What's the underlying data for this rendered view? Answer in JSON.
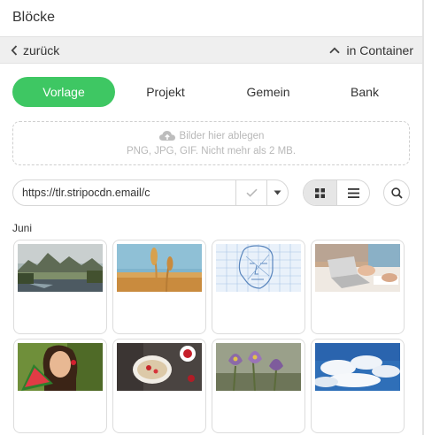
{
  "panel": {
    "title": "Blöcke"
  },
  "navbar": {
    "back_label": "zurück",
    "container_label": "in Container"
  },
  "tabs": [
    {
      "label": "Vorlage",
      "active": true
    },
    {
      "label": "Projekt",
      "active": false
    },
    {
      "label": "Gemein",
      "active": false
    },
    {
      "label": "Bank",
      "active": false
    }
  ],
  "dropzone": {
    "line1": "Bilder hier ablegen",
    "line2": "PNG, JPG, GIF. Nicht mehr als 2 MB.",
    "icon": "cloud-upload-icon"
  },
  "url_field": {
    "value": "https://tlr.stripocdn.email/c"
  },
  "view": {
    "selected": "grid"
  },
  "gallery": {
    "section_label": "Juni",
    "images": [
      {
        "subject": "mountain-lake"
      },
      {
        "subject": "wheat-field"
      },
      {
        "subject": "wireframe-face"
      },
      {
        "subject": "laptop-workspace"
      },
      {
        "subject": "woman-with-watermelon"
      },
      {
        "subject": "oatmeal-bowl"
      },
      {
        "subject": "purple-crocus-flowers"
      },
      {
        "subject": "blue-sky-clouds"
      }
    ]
  },
  "colors": {
    "accent": "#3ec763",
    "navbar_bg": "#efefef",
    "border": "#d6d6d6"
  }
}
